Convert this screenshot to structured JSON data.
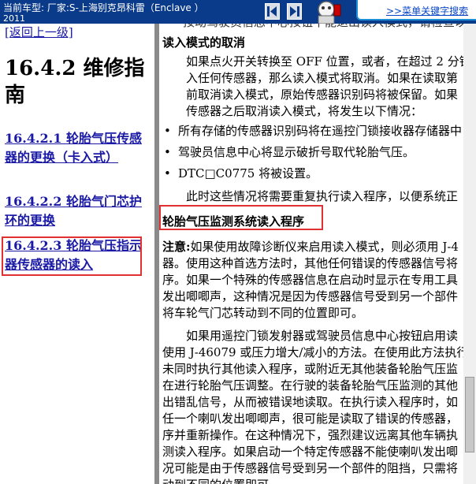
{
  "topbar": {
    "vehicle_label": "当前车型:   厂家:S-上海别克昂科雷（Enclave ）",
    "year": "2011",
    "menu_link": ">>菜单关键字搜索"
  },
  "left": {
    "back_link": "[返回上一级]",
    "section_title": "16.4.2 维修指南",
    "toc": [
      {
        "label": "16.4.2.1 轮胎气压传感器的更换（卡入式）"
      },
      {
        "label": "16.4.2.2 轮胎气门芯护环的更换"
      },
      {
        "label": "16.4.2.3 轮胎气压指示器传感器的读入"
      }
    ]
  },
  "right": {
    "partial_line": "按动驾驶员信息中心按钮不能退出读入模式，请检查以下情况。",
    "heading1": "读入模式的取消",
    "para1": [
      "如果点火开关转换至 OFF 位置，或者，在超过 2 分钟",
      "入任何传感器，那么读入模式将取消。如果在读取第",
      "前取消读入模式，原始传感器识别码将被保留。如果",
      "传感器之后取消读入模式，将发生以下情况："
    ],
    "bullets": [
      "所有存储的传感器识别码将在遥控门锁接收器存储器中",
      "驾驶员信息中心将显示破折号取代轮胎气压。",
      "DTC□C0775 将被设置。"
    ],
    "para2": "此时这些情况将需要重复执行读入程序，以便系统正",
    "heading2": "轮胎气压监测系统读入程序",
    "note_label": "注意:",
    "note": [
      "如果使用故障诊断仪来启用读入模式，则必须用 J-4",
      "器。使用这种首选方法时，其他任何错误的传感器信号将",
      "序。如果一个特殊的传感器信息在启动时显示在专用工具",
      "发出唧唧声，这种情况是因为传感器信号受到另一个部件",
      "将车轮气门芯转动到不同的位置即可。"
    ],
    "para3": [
      "如果用遥控门锁发射器或驾驶员信息中心按钮启用读",
      "使用 J-46079 或压力增大/减小的方法。在使用此方法执行",
      "未同时执行其他读入程序，或附近无其他装备轮胎气压监",
      "在进行轮胎气压调整。在行驶的装备轮胎气压监测的其他",
      "出错乱信号，从而被错误地读取。在执行读入程序时，如",
      "任一个喇叭发出唧唧声，很可能是读取了错误的传感器，",
      "序并重新操作。在这种情况下，强烈建议远离其他车辆执",
      "测读入程序。如果启动一个特定传感器不能使喇叭发出唧",
      "况可能是由于传感器信号受到另一个部件的阻挡，只需将",
      "动到不同的位置即可。"
    ]
  },
  "colors": {
    "topbar_bg": "#0a3a8a",
    "link": "#1a1aa6",
    "highlight_box": "#e03030",
    "menu_border": "#1b8fd6"
  },
  "icons": [
    "back-arrow-icon",
    "forward-arrow-icon",
    "mascot-icon"
  ]
}
